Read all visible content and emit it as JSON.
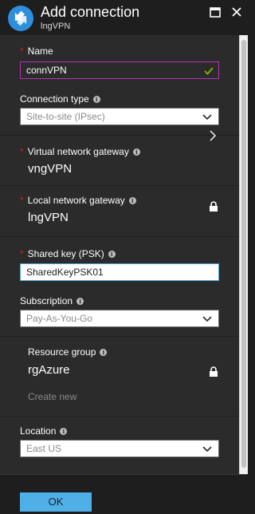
{
  "header": {
    "title": "Add connection",
    "subtitle": "lngVPN",
    "icon": "connection-arrows-icon",
    "brand_color": "#2f8fdd"
  },
  "form": {
    "name": {
      "label": "Name",
      "value": "connVPN",
      "required": true,
      "valid": true
    },
    "connection_type": {
      "label": "Connection type",
      "value": "Site-to-site (IPsec)"
    },
    "virtual_network_gateway": {
      "label": "Virtual network gateway",
      "value": "vngVPN",
      "required": true
    },
    "local_network_gateway": {
      "label": "Local network gateway",
      "value": "lngVPN",
      "required": true,
      "locked": true
    },
    "shared_key": {
      "label": "Shared key (PSK)",
      "value": "SharedKeyPSK01",
      "required": true
    },
    "subscription": {
      "label": "Subscription",
      "value": "Pay-As-You-Go"
    },
    "resource_group": {
      "label": "Resource group",
      "value": "rgAzure",
      "locked": true,
      "create_new": "Create new"
    },
    "location": {
      "label": "Location",
      "value": "East US"
    }
  },
  "footer": {
    "ok_label": "OK"
  },
  "colors": {
    "panel_bg": "#2b2b2b",
    "header_bg": "#1e1e1e",
    "required_marker": "#e81123",
    "name_border": "#b533b5",
    "key_border": "#4fa8e0",
    "check": "#7fba00",
    "ok_button": "#4fb0e8"
  }
}
